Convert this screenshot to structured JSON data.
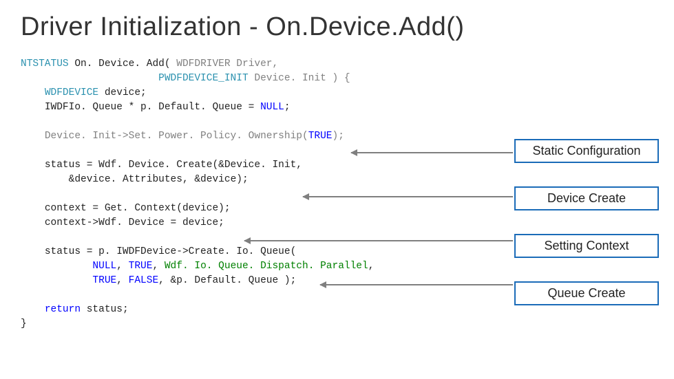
{
  "title": "Driver Initialization - On.Device.Add()",
  "code": {
    "l1": {
      "t1": "NTSTATUS",
      "t2": " On. Device. Add( ",
      "t3": "WDFDRIVER",
      "t4": " Driver,",
      "indent_spaces": "                       ",
      "t5": "PWDFDEVICE_INIT",
      "t6": " Device. Init ) {"
    },
    "l2": {
      "pad": "    ",
      "t1": "WDFDEVICE",
      "t2": " device;"
    },
    "l3": {
      "pad": "    ",
      "t1": "IWDFIo. Queue * p. Default. Queue = ",
      "t2": "NULL",
      "t3": ";"
    },
    "l4": {
      "pad": "    ",
      "t1": "Device. Init->Set. Power. Policy. Ownership(",
      "t2": "TRUE",
      "t3": ");"
    },
    "l5": {
      "pad": "    ",
      "t1": "status = Wdf. Device. Create(&Device. Init,",
      "pad2": "        ",
      "t2": "&device. Attributes, &device);"
    },
    "l6": {
      "pad": "    ",
      "t1": "context = Get. Context(device);",
      "pad2": "    ",
      "t2": "context->Wdf. Device = device;"
    },
    "l7": {
      "pad": "    ",
      "t1": "status = p. IWDFDevice->Create. Io. Queue(",
      "pad2": "            ",
      "t2": "NULL",
      "t3": ", ",
      "t4": "TRUE",
      "t5": ", ",
      "t6": "Wdf. Io. Queue. Dispatch. Parallel",
      "t7": ",",
      "pad3": "            ",
      "t8": "TRUE",
      "t9": ", ",
      "t10": "FALSE",
      "t11": ", &p. Default. Queue );"
    },
    "l8": {
      "pad": "    ",
      "t1": "return",
      "t2": " status;"
    },
    "l9": "}"
  },
  "callouts": {
    "c1": "Static Configuration",
    "c2": "Device Create",
    "c3": "Setting Context",
    "c4": "Queue Create"
  }
}
